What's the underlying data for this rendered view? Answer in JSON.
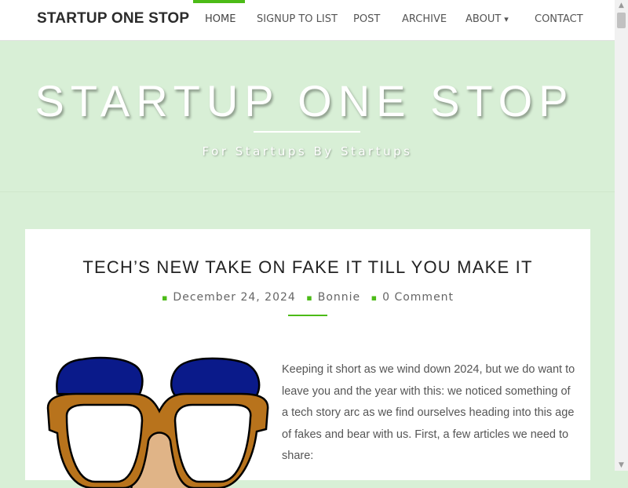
{
  "header": {
    "brand": "STARTUP ONE STOP",
    "nav": [
      {
        "label": "HOME"
      },
      {
        "label": "SIGNUP TO LIST"
      },
      {
        "label": "POST"
      },
      {
        "label": "ARCHIVE"
      },
      {
        "label": "ABOUT"
      },
      {
        "label": "CONTACT"
      }
    ],
    "accent_color": "#4cbb17"
  },
  "hero": {
    "title": "STARTUP ONE STOP",
    "tagline": "For Startups By Startups",
    "background_color": "#d8efd6"
  },
  "post": {
    "title": "TECH’S NEW TAKE ON FAKE IT TILL YOU MAKE IT",
    "date": "December 24, 2024",
    "author": "Bonnie",
    "comments": "0 Comment",
    "body": "Keeping it short as we wind down 2024, but we do want to leave you and the year with this: we noticed something of a tech story arc as we find ourselves heading into this age of fakes and bear with us. First, a few articles we need to share:"
  },
  "icons": {
    "about_dropdown": "chevron-down-icon",
    "date": "calendar-icon",
    "author": "user-icon",
    "comments": "comment-icon"
  }
}
